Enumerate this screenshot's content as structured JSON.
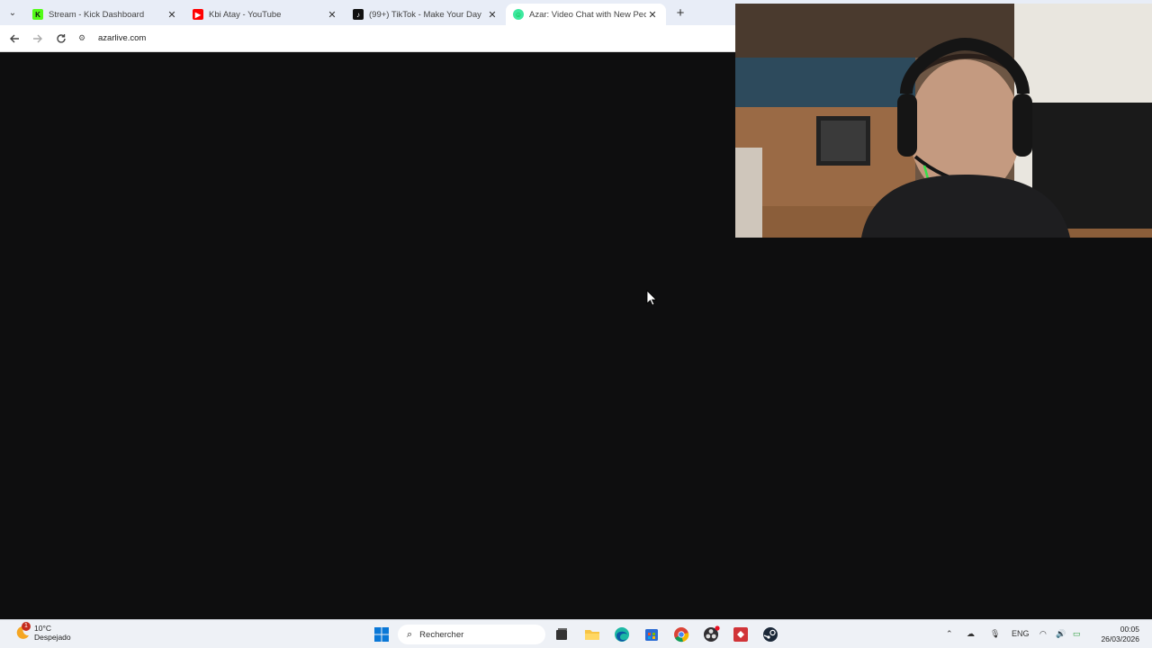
{
  "browser": {
    "tabs": [
      {
        "title": "Stream - Kick Dashboard",
        "favicon": "kick-icon",
        "color": "#53fc18",
        "active": false
      },
      {
        "title": "Kbi Atay - YouTube",
        "favicon": "youtube-icon",
        "color": "#ff0000",
        "active": false
      },
      {
        "title": "(99+) TikTok - Make Your Day",
        "favicon": "tiktok-icon",
        "color": "#111111",
        "active": false
      },
      {
        "title": "Azar: Video Chat with New Peo",
        "favicon": "azar-icon",
        "color": "#3de8a0",
        "active": true
      }
    ],
    "new_tab_label": "+",
    "url": "azarlive.com"
  },
  "taskbar": {
    "weather": {
      "temp": "10°C",
      "condition": "Despejado",
      "badge": "1"
    },
    "search_placeholder": "Rechercher",
    "language": "ENG",
    "time": "00:05",
    "date": "26/03/2026",
    "pinned_icons": [
      "windows-start-icon",
      "task-view-icon",
      "file-explorer-icon",
      "edge-icon",
      "store-icon",
      "chrome-icon",
      "obs-icon",
      "app-red-icon",
      "steam-icon"
    ]
  },
  "colors": {
    "page_background": "#0e0e0f",
    "tabstrip": "#e8edf7",
    "taskbar": "#eef1f6"
  }
}
